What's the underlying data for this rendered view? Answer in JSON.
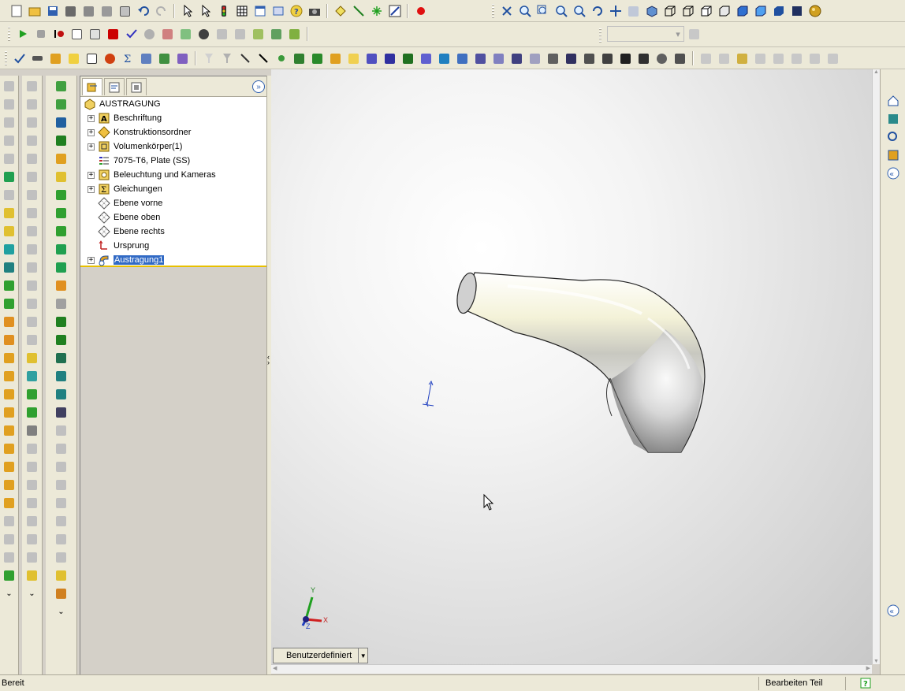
{
  "tree": {
    "root_label": "AUSTRAGUNG",
    "items": [
      {
        "label": "Beschriftung",
        "icon": "annotation-icon",
        "expandable": true
      },
      {
        "label": "Konstruktionsordner",
        "icon": "design-binder-icon",
        "expandable": true
      },
      {
        "label": "Volumenkörper(1)",
        "icon": "solid-bodies-folder-icon",
        "expandable": true
      },
      {
        "label": "7075-T6, Plate (SS)",
        "icon": "material-icon",
        "expandable": false
      },
      {
        "label": "Beleuchtung und Kameras",
        "icon": "lights-cameras-icon",
        "expandable": true
      },
      {
        "label": "Gleichungen",
        "icon": "equations-icon",
        "expandable": true
      },
      {
        "label": "Ebene vorne",
        "icon": "plane-icon",
        "expandable": false
      },
      {
        "label": "Ebene oben",
        "icon": "plane-icon",
        "expandable": false
      },
      {
        "label": "Ebene rechts",
        "icon": "plane-icon",
        "expandable": false
      },
      {
        "label": "Ursprung",
        "icon": "origin-icon",
        "expandable": false
      },
      {
        "label": "Austragung1",
        "icon": "sweep-feature-icon",
        "expandable": true,
        "selected": true
      }
    ]
  },
  "viewport": {
    "view_orientation_label": "Benutzerdefiniert",
    "triad": {
      "x": "X",
      "y": "Y",
      "z": "Z"
    }
  },
  "status": {
    "left": "Bereit",
    "mode": "Bearbeiten Teil",
    "help_icon": "help-icon"
  },
  "colors": {
    "selection": "#316ac5",
    "toolbar_bg": "#ece9d8",
    "tree_separator": "#e8c000"
  }
}
